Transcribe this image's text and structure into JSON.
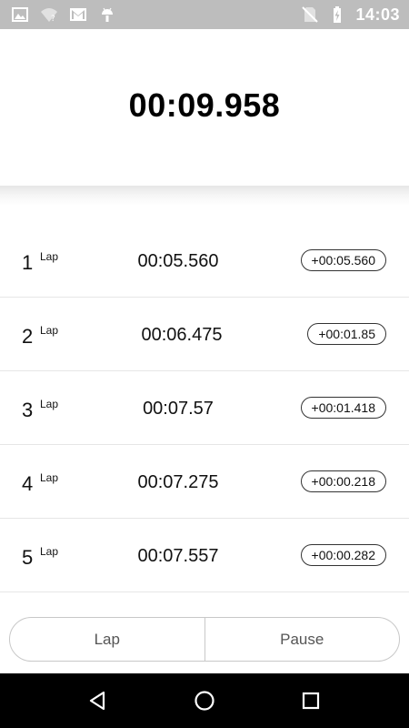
{
  "status_bar": {
    "time": "14:03",
    "left_icons": [
      "image-icon",
      "wifi-question-icon",
      "gmail-icon",
      "android-icon"
    ],
    "right_icons": [
      "no-sim-icon",
      "battery-charging-icon"
    ]
  },
  "timer": {
    "display": "00:09.958"
  },
  "laps": [
    {
      "number": "1",
      "label": "Lap",
      "time": "00:05.560",
      "diff": "+00:05.560"
    },
    {
      "number": "2",
      "label": "Lap",
      "time": "00:06.475",
      "diff": "+00:01.85"
    },
    {
      "number": "3",
      "label": "Lap",
      "time": "00:07.57",
      "diff": "+00:01.418"
    },
    {
      "number": "4",
      "label": "Lap",
      "time": "00:07.275",
      "diff": "+00:00.218"
    },
    {
      "number": "5",
      "label": "Lap",
      "time": "00:07.557",
      "diff": "+00:00.282"
    }
  ],
  "controls": {
    "lap_label": "Lap",
    "pause_label": "Pause"
  },
  "nav_bar": {
    "icons": [
      "back-icon",
      "home-icon",
      "recents-icon"
    ]
  },
  "colors": {
    "status_bar": "#bdbdbd",
    "nav_bar": "#000000",
    "text": "#111111",
    "button_text": "#555555",
    "border": "#c8c8c8"
  }
}
